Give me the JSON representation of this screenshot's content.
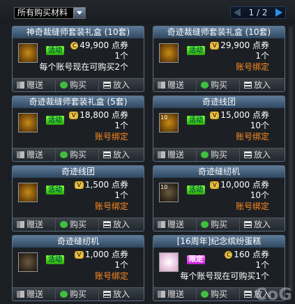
{
  "filter": {
    "selected": "所有购买材料"
  },
  "pager": {
    "text": "1 / 2"
  },
  "buttons": {
    "gift": "赠送",
    "buy": "购买",
    "cart": "放入"
  },
  "cards": [
    {
      "title": "神奇裁缝师套装礼盒 (10套)",
      "tag": "活动",
      "coin": "C",
      "price": "49,900  点券",
      "qty": "1个",
      "note": "每个账号现在可购买2个",
      "note_style": "white",
      "thumb": "gold-box"
    },
    {
      "title": "奇迹裁缝师套装礼盒 (10套)",
      "tag": "活动",
      "coin": "VIP",
      "price": "29,900  点券",
      "qty": "1个",
      "note": "账号绑定",
      "note_style": "orange",
      "thumb": "gold-box"
    },
    {
      "title": "奇迹裁缝师套装礼盒 (5套)",
      "tag": "活动",
      "coin": "VIP",
      "price": "18,800  点券",
      "qty": "1个",
      "note": "账号绑定",
      "note_style": "orange",
      "thumb": "gold-box"
    },
    {
      "title": "奇迹线团",
      "tag": "活动",
      "coin": "VIP",
      "price": "15,000  点券",
      "qty": "10个",
      "note": "账号绑定",
      "note_style": "orange",
      "thumb": "thread",
      "badge": "10"
    },
    {
      "title": "奇迹线团",
      "tag": "活动",
      "coin": "VIP",
      "price": "1,500  点券",
      "qty": "1个",
      "note": "账号绑定",
      "note_style": "orange",
      "thumb": "thread"
    },
    {
      "title": "奇迹缝纫机",
      "tag": "活动",
      "coin": "VIP",
      "price": "10,000  点券",
      "qty": "10个",
      "note": "账号绑定",
      "note_style": "orange",
      "thumb": "machine",
      "badge": "10"
    },
    {
      "title": "奇迹缝纫机",
      "tag": "活动",
      "coin": "VIP",
      "price": "1,000  点券",
      "qty": "1个",
      "note": "账号绑定",
      "note_style": "orange",
      "thumb": "machine"
    },
    {
      "title": "[16周年]纪念缤纷蛋糕",
      "tag": "限定",
      "coin": "C",
      "price": "160  点券",
      "qty": "1个",
      "note": "每个账号现在可购买1个",
      "note_style": "white",
      "thumb": "cake"
    }
  ],
  "watermark": "CoG"
}
